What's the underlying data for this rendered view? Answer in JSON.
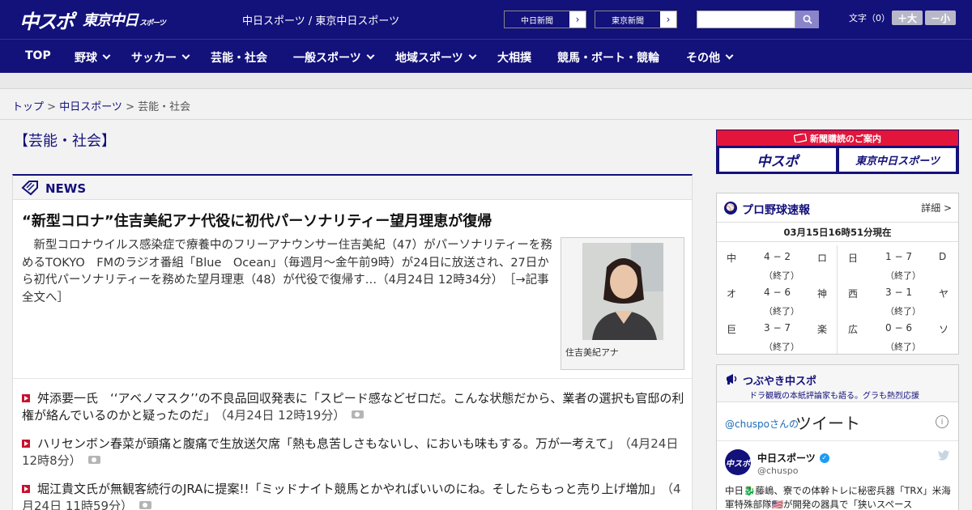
{
  "header": {
    "logo_main": "中スポ",
    "logo_tokyo": "東京中日",
    "logo_tokyo_small": "スポーツ",
    "site_names": "中日スポーツ / 東京中日スポーツ",
    "ext_links": [
      "中日新聞",
      "東京新聞"
    ],
    "search_placeholder": "",
    "font_size_label": "文字（0）",
    "font_bigger": "＋大",
    "font_smaller": "－小"
  },
  "nav": {
    "items": [
      {
        "label": "TOP",
        "has_menu": false
      },
      {
        "label": "野球",
        "has_menu": true
      },
      {
        "label": "サッカー",
        "has_menu": true
      },
      {
        "label": "芸能・社会",
        "has_menu": false
      },
      {
        "label": "一般スポーツ",
        "has_menu": true
      },
      {
        "label": "地域スポーツ",
        "has_menu": true
      },
      {
        "label": "大相撲",
        "has_menu": false
      },
      {
        "label": "競馬・ボート・競輪",
        "has_menu": false
      },
      {
        "label": "その他",
        "has_menu": true
      }
    ]
  },
  "breadcrumb": {
    "top": "トップ",
    "sep": " > ",
    "section": "中日スポーツ",
    "current": "芸能・社会"
  },
  "page": {
    "heading": "【芸能・社会】"
  },
  "news": {
    "label": "NEWS",
    "lead": {
      "title": "“新型コロナ”住吉美紀アナ代役に初代パーソナリティー望月理恵が復帰",
      "body": "新型コロナウイルス感染症で療養中のフリーアナウンサー住吉美紀（47）がパーソナリティーを務めるTOKYO　FMのラジオ番組「Blue　Ocean」（毎週月～金午前9時）が24日に放送され、27日から初代パーソナリティーを務めた望月理恵（48）が代役で復帰す…（4月24日 12時34分）",
      "more": "［→記事全文へ］",
      "photo_caption": "住吉美紀アナ"
    },
    "items": [
      {
        "text": "舛添要一氏　‘‘アベノマスク’’の不良品回収発表に「スピード感などゼロだ。こんな状態だから、業者の選択も官邸の利権が絡んでいるのかと疑ったのだ」",
        "time": "（4月24日 12時19分）"
      },
      {
        "text": "ハリセンボン春菜が頭痛と腹痛で生放送欠席「熱も息苦しさもないし、においも味もする。万が一考えて」",
        "time": "（4月24日 12時8分）"
      },
      {
        "text": "堀江貴文氏が無観客続行のJRAに提案!!「ミッドナイト競馬とかやればいいのにね。そしたらもっと売り上げ増加」",
        "time": "（4月24日 11時59分）"
      }
    ]
  },
  "subscription": {
    "title": "新聞購読のご案内",
    "buttons": [
      "中スポ",
      "東京中日スポーツ"
    ]
  },
  "baseball": {
    "title": "プロ野球速報",
    "detail": "詳細 >",
    "time": "03月15日16時51分現在",
    "games": [
      {
        "t1": "中",
        "score": "4 − 2",
        "status": "（終了）",
        "t2": "ロ"
      },
      {
        "t1": "オ",
        "score": "4 − 6",
        "status": "（終了）",
        "t2": "神"
      },
      {
        "t1": "巨",
        "score": "3 − 7",
        "status": "（終了）",
        "t2": "楽"
      },
      {
        "t1": "日",
        "score": "1 − 7",
        "status": "（終了）",
        "t2": "D"
      },
      {
        "t1": "西",
        "score": "3 − 1",
        "status": "（終了）",
        "t2": "ヤ"
      },
      {
        "t1": "広",
        "score": "0 − 6",
        "status": "（終了）",
        "t2": "ソ"
      }
    ]
  },
  "tweets": {
    "title": "つぶやき中スポ",
    "subtitle": "ドラ観戦の本紙評論家も語る。グラも熱烈応援",
    "handle": "@chuspoさんの",
    "tweet_word": "ツイート",
    "account_name": "中日スポーツ",
    "screen_name": "@chuspo",
    "avatar_text": "中スポ",
    "text": "中日🐉藤嶋、寮での体幹トレに秘密兵器「TRX」米海軍特殊部隊🇺🇸が開発の器具で「狭いスペース"
  },
  "colors": {
    "brand_navy": "#13117a",
    "accent_red": "#e3153a",
    "bullet_red": "#c8102e",
    "link_blue": "#1b6bb8"
  }
}
